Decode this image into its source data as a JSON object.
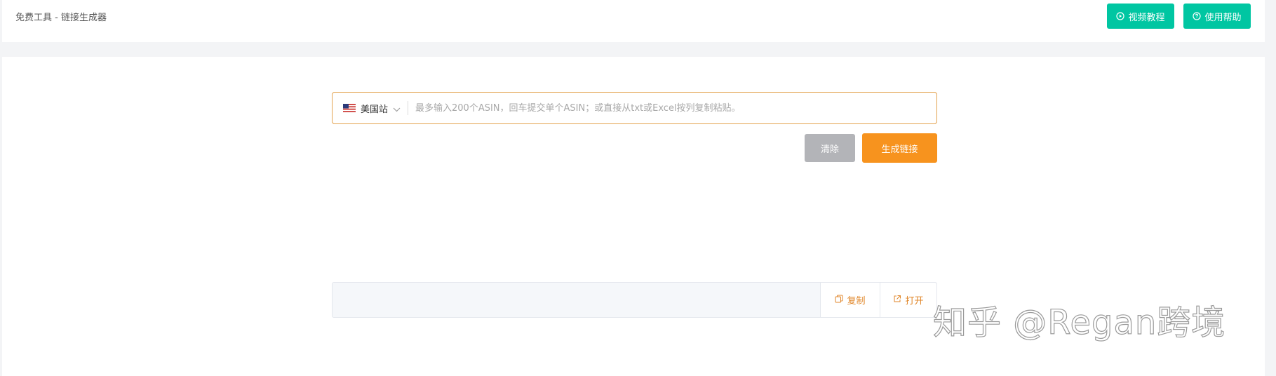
{
  "header": {
    "title": "免费工具 - 链接生成器",
    "video_button": "视频教程",
    "help_button": "使用帮助",
    "accent_color": "#00c6a2"
  },
  "generator": {
    "region": "美国站",
    "region_icon": "us-flag-icon",
    "input_value": "",
    "input_placeholder": "最多输入200个ASIN，回车提交单个ASIN；或直接从txt或Excel按列复制粘贴。",
    "clear_button": "清除",
    "generate_button": "生成链接",
    "primary_color": "#f7931e"
  },
  "result": {
    "value": "",
    "copy_button": "复制",
    "open_button": "打开"
  },
  "watermark": "知乎 @Regan跨境"
}
